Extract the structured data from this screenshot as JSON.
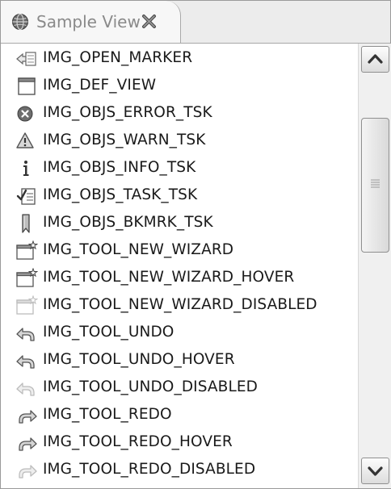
{
  "view": {
    "title": "Sample View",
    "tab_icon": "globe-icon",
    "close_icon": "close-icon"
  },
  "list": {
    "items": [
      {
        "label": "IMG_OPEN_MARKER",
        "icon": "open-marker-icon"
      },
      {
        "label": "IMG_DEF_VIEW",
        "icon": "default-view-icon"
      },
      {
        "label": "IMG_OBJS_ERROR_TSK",
        "icon": "error-icon"
      },
      {
        "label": "IMG_OBJS_WARN_TSK",
        "icon": "warning-icon"
      },
      {
        "label": "IMG_OBJS_INFO_TSK",
        "icon": "info-icon"
      },
      {
        "label": "IMG_OBJS_TASK_TSK",
        "icon": "task-icon"
      },
      {
        "label": "IMG_OBJS_BKMRK_TSK",
        "icon": "bookmark-icon"
      },
      {
        "label": "IMG_TOOL_NEW_WIZARD",
        "icon": "new-wizard-icon"
      },
      {
        "label": "IMG_TOOL_NEW_WIZARD_HOVER",
        "icon": "new-wizard-hover-icon"
      },
      {
        "label": "IMG_TOOL_NEW_WIZARD_DISABLED",
        "icon": "new-wizard-disabled-icon"
      },
      {
        "label": "IMG_TOOL_UNDO",
        "icon": "undo-icon"
      },
      {
        "label": "IMG_TOOL_UNDO_HOVER",
        "icon": "undo-hover-icon"
      },
      {
        "label": "IMG_TOOL_UNDO_DISABLED",
        "icon": "undo-disabled-icon"
      },
      {
        "label": "IMG_TOOL_REDO",
        "icon": "redo-icon"
      },
      {
        "label": "IMG_TOOL_REDO_HOVER",
        "icon": "redo-hover-icon"
      },
      {
        "label": "IMG_TOOL_REDO_DISABLED",
        "icon": "redo-disabled-icon"
      }
    ]
  },
  "scrollbar": {
    "up_icon": "chevron-up-icon",
    "down_icon": "chevron-down-icon",
    "grip_icon": "grip-icon"
  }
}
